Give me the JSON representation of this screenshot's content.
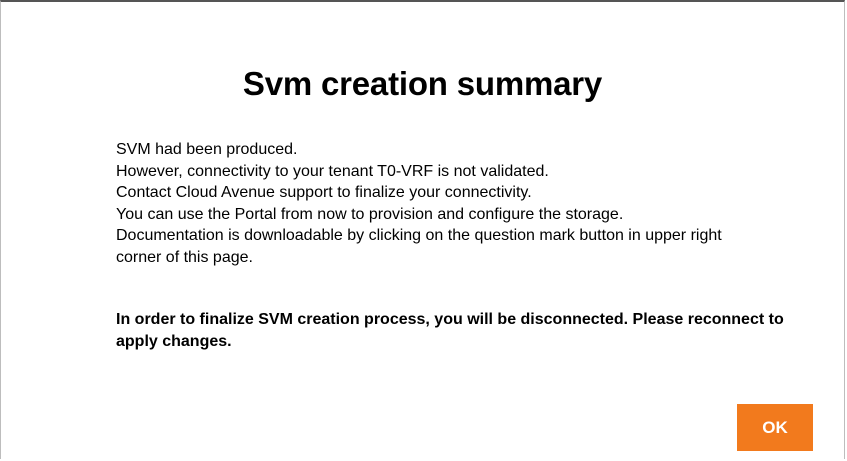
{
  "dialog": {
    "title": "Svm creation summary",
    "lines": [
      "SVM had been produced.",
      "However, connectivity to your tenant T0-VRF is not validated.",
      "Contact Cloud Avenue support to finalize your connectivity.",
      "You can use the Portal from now to provision and configure the storage.",
      "Documentation is downloadable by clicking on the question mark button in upper right",
      "corner of this page."
    ],
    "notice": "In order to finalize SVM creation process, you will be disconnected. Please reconnect to apply changes.",
    "ok_label": "OK"
  },
  "colors": {
    "button_bg": "#f27a1d",
    "button_text": "#ffffff",
    "text": "#000000"
  }
}
